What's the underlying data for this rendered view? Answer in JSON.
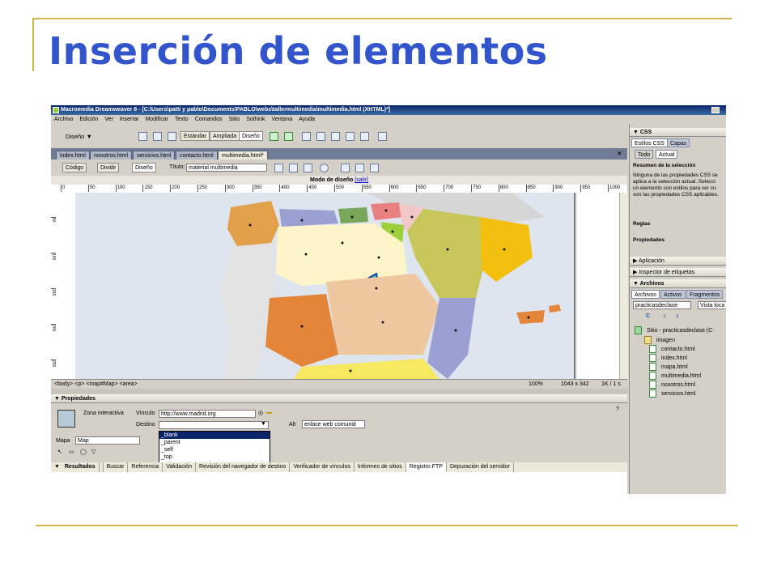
{
  "slide": {
    "title": "Inserción de elementos",
    "accent_color": "#3355cc",
    "line_color": "#cdb54a"
  },
  "window": {
    "title": "Macromedia Dreamweaver 8 - [C:\\Users\\patti y pablo\\Documents\\PABLO\\webs\\tallermultimedia\\multimedia.html (XHTML)*]",
    "menu": [
      "Archivo",
      "Edición",
      "Ver",
      "Insertar",
      "Modificar",
      "Texto",
      "Comandos",
      "Sitio",
      "Sothink",
      "Ventana",
      "Ayuda"
    ]
  },
  "insert_bar": {
    "category": "Diseño",
    "view_buttons": [
      "Estándar",
      "Ampliada",
      "Diseño"
    ]
  },
  "doc_tabs": [
    "index.html",
    "nosotros.html",
    "servicios.html",
    "contacto.html",
    "multimedia.html*"
  ],
  "doc_toolbar": {
    "code": "Código",
    "split": "Dividir",
    "design": "Diseño",
    "title_label": "Título:",
    "title_value": "material multimedia"
  },
  "mode_bar": {
    "text": "Modo de diseño",
    "exit_link": "[salir]"
  },
  "ruler_ticks": [
    "0",
    "50",
    "100",
    "150",
    "200",
    "250",
    "300",
    "350",
    "400",
    "450",
    "500",
    "550",
    "600",
    "650",
    "700",
    "750",
    "800",
    "850",
    "900",
    "950",
    "1000"
  ],
  "vruler_ticks": [
    "50",
    "100",
    "150",
    "200",
    "250"
  ],
  "status_bar": {
    "tags": "<body> <p> <map#Map> <area>",
    "zoom": "100%",
    "size": "1043 x 342",
    "download": "1K / 1 s"
  },
  "properties": {
    "header": "Propiedades",
    "type": "Zona interactiva",
    "link_label": "Vínculo",
    "link_value": "http://www.madrid.org",
    "target_label": "Destino",
    "target_value": "",
    "alt_label": "Alt",
    "alt_value": "enlace web comunid",
    "map_label": "Mapa",
    "map_value": "Map",
    "target_options": [
      "_blank",
      "_parent",
      "_self",
      "_top"
    ]
  },
  "results_bar": {
    "header": "Resultados",
    "tabs": [
      "Buscar",
      "Referencia",
      "Validación",
      "Revisión del navegador de destino",
      "Verificador de vínculos",
      "Informes de sitios",
      "Registro FTP",
      "Depuración del servidor"
    ]
  },
  "right_panel": {
    "css_header": "CSS",
    "css_tabs": [
      "Estilos CSS",
      "Capas"
    ],
    "mode_tabs": [
      "Todo",
      "Actual"
    ],
    "summary_title": "Resumen de la selección",
    "summary_lines": [
      "Ninguna de las propiedades CSS se",
      "aplica a la selección actual. Selecci",
      "un elemento con estilos para ver cu",
      "son las propiedades CSS aplicables."
    ],
    "rules": "Reglas",
    "properties": "Propiedades",
    "application": "Aplicación",
    "tag_inspector": "Inspector de etiquetas",
    "files_header": "Archivos",
    "files_tabs": [
      "Archivos",
      "Activos",
      "Fragmentos"
    ],
    "site_select": "practicasdeclase",
    "view_select": "Vista loca",
    "tree_root": "Sitio - practicasdeclase (C:",
    "folder": "imagen",
    "files": [
      "contacto.html",
      "index.html",
      "mapa.html",
      "multimedia.html",
      "nosotros.html",
      "servicios.html"
    ]
  }
}
